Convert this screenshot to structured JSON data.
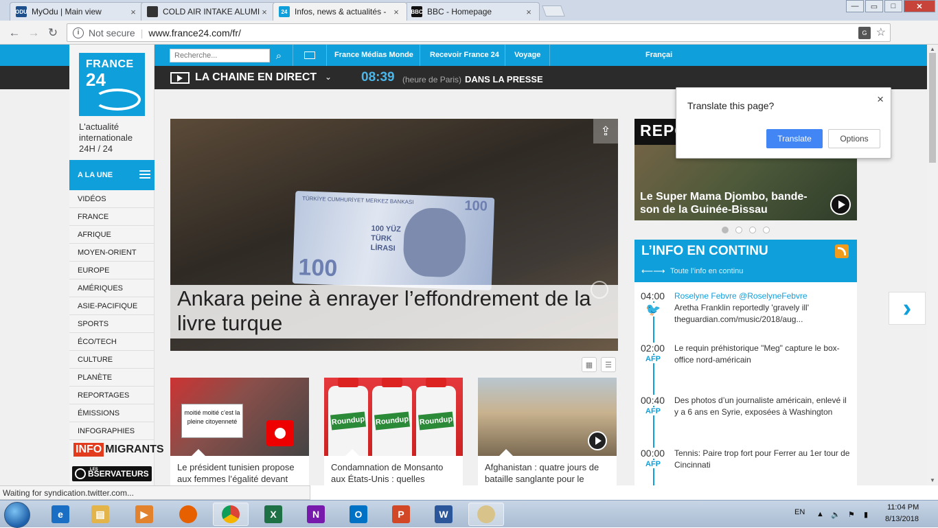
{
  "browser": {
    "tabs": [
      {
        "title": "MyOdu | Main view",
        "favicon": "odu-icon",
        "active": false
      },
      {
        "title": "COLD AIR INTAKE ALUMI",
        "favicon": "car-icon",
        "active": false
      },
      {
        "title": "Infos, news & actualités -",
        "favicon": "france24-icon",
        "active": true
      },
      {
        "title": "BBC - Homepage",
        "favicon": "bbc-icon",
        "active": false
      }
    ],
    "tab_close_label": "×",
    "address_security": "Not secure",
    "address_url": "www.france24.com/fr/",
    "ext_badge": "7",
    "status_text": "Waiting for syndication.twitter.com..."
  },
  "translate_popup": {
    "question": "Translate this page?",
    "translate_label": "Translate",
    "options_label": "Options",
    "close_label": "×"
  },
  "site": {
    "logo_line1": "FRANCE",
    "logo_line2": "24",
    "tagline": [
      "L'actualité",
      "internationale",
      "24H / 24"
    ],
    "search_placeholder": "Recherche...",
    "topnav": [
      "France Médias Monde",
      "Recevoir France 24",
      "Voyage",
      "Françai"
    ],
    "live_label": "LA CHAINE EN DIRECT",
    "clock_time": "08:39",
    "clock_note": "(heure de Paris)",
    "press_label": "DANS LA PRESSE",
    "a_la_une": "A LA UNE",
    "menu": [
      "VIDÉOS",
      "FRANCE",
      "AFRIQUE",
      "MOYEN-ORIENT",
      "EUROPE",
      "AMÉRIQUES",
      "ASIE-PACIFIQUE",
      "SPORTS",
      "ÉCO/TECH",
      "CULTURE",
      "PLANÈTE",
      "REPORTAGES",
      "ÉMISSIONS",
      "INFOGRAPHIES"
    ],
    "infomigrants": [
      "INFO",
      "MIGRANTS"
    ],
    "observateurs": "BSERVATEURS",
    "observateurs_small": "LES"
  },
  "hero": {
    "headline": "Ankara peine à enrayer l’effondrement de la livre turque",
    "bill_header": "TÜRKİYE CUMHURİYET MERKEZ BANKASI",
    "bill_value": "100",
    "bill_text": "100 YÜZ TÜRK LİRASI"
  },
  "cards": [
    {
      "text": "Le président tunisien propose aux femmes l’égalité devant",
      "sign": "moitié moitié c’est la pleine citoyenneté"
    },
    {
      "text": "Condamnation de Monsanto aux États-Unis : quelles conséquences ?",
      "bottle_label": "Roundup"
    },
    {
      "text": "Afghanistan : quatre jours de bataille sanglante pour le contrôle de Ghazni"
    }
  ],
  "reporters": {
    "logo": "REPORTERS",
    "caption": "Le Super Mama Djombo, bande-son de la Guinée-Bissau"
  },
  "continu": {
    "title": "L’INFO EN CONTINU",
    "subtitle": "Toute l’info en continu",
    "entries": [
      {
        "time": "04:00",
        "source": "",
        "author": "Roselyne Febvre @RoselyneFebvre",
        "text": "Aretha Franklin reportedly 'gravely ill' theguardian.com/music/2018/aug..."
      },
      {
        "time": "02:00",
        "source": "AFP",
        "author": "",
        "text": "Le requin préhistorique \"Meg\" capture le box-office nord-américain"
      },
      {
        "time": "00:40",
        "source": "AFP",
        "author": "",
        "text": "Des photos d’un journaliste américain, enlevé il y a 6 ans en Syrie, exposées à Washington"
      },
      {
        "time": "00:00",
        "source": "AFP",
        "author": "",
        "text": "Tennis: Paire trop fort pour Ferrer au 1er tour de Cincinnati"
      }
    ]
  },
  "taskbar": {
    "apps": [
      "ie-icon",
      "explorer-icon",
      "media-player-icon",
      "firefox-icon",
      "chrome-icon",
      "excel-icon",
      "onenote-icon",
      "outlook-icon",
      "powerpoint-icon",
      "word-icon",
      "paint-icon"
    ],
    "lang": "EN",
    "time": "11:04 PM",
    "date": "8/13/2018"
  },
  "colors": {
    "brand": "#0f9fdb",
    "dark_bar": "#2b2b2b",
    "translate_btn": "#4285f4"
  }
}
